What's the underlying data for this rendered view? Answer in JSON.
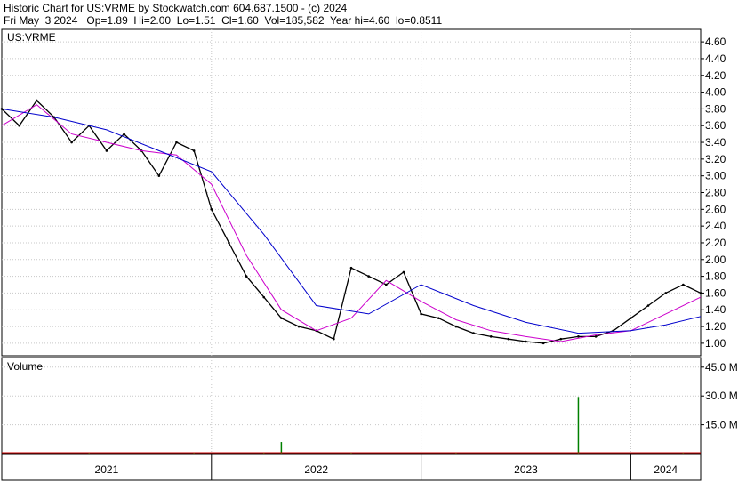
{
  "header": {
    "title": "Historic Chart for US:VRME by Stockwatch.com 604.687.1500 - (c) 2024",
    "quote": "Fri May  3 2024   Op=1.89  Hi=2.00  Lo=1.51  Cl=1.60  Vol=185,582  Year hi=4.60  lo=0.8511"
  },
  "colors": {
    "price": "#000000",
    "ma_short": "#cc00cc",
    "ma_long": "#0000cc",
    "volume_up": "#008000",
    "volume_down": "#cc0000",
    "grid": "#c8c8c8",
    "frame": "#000000"
  },
  "chart_data": [
    {
      "type": "line",
      "panel": "price",
      "symbol_label": "US:VRME",
      "ylim": [
        0.85,
        4.75
      ],
      "y_ticks": [
        "4.60",
        "4.40",
        "4.20",
        "4.00",
        "3.80",
        "3.60",
        "3.40",
        "3.20",
        "3.00",
        "2.80",
        "2.60",
        "2.40",
        "2.20",
        "2.00",
        "1.80",
        "1.60",
        "1.40",
        "1.20",
        "1.00"
      ],
      "x_ticks": [
        "2021",
        "2022",
        "2023",
        "2024"
      ],
      "x_range": [
        "2021-01",
        "2024-05"
      ],
      "grid": true,
      "series": [
        {
          "role": "price",
          "x": [
            "2021-01",
            "2021-02",
            "2021-03",
            "2021-04",
            "2021-05",
            "2021-06",
            "2021-07",
            "2021-08",
            "2021-09",
            "2021-10",
            "2021-11",
            "2021-12",
            "2022-01",
            "2022-02",
            "2022-03",
            "2022-04",
            "2022-05",
            "2022-06",
            "2022-07",
            "2022-08",
            "2022-09",
            "2022-10",
            "2022-11",
            "2022-12",
            "2023-01",
            "2023-02",
            "2023-03",
            "2023-04",
            "2023-05",
            "2023-06",
            "2023-07",
            "2023-08",
            "2023-09",
            "2023-10",
            "2023-11",
            "2023-12",
            "2024-01",
            "2024-02",
            "2024-03",
            "2024-04",
            "2024-05"
          ],
          "values": [
            3.8,
            3.6,
            3.9,
            3.7,
            3.4,
            3.6,
            3.3,
            3.5,
            3.3,
            3.0,
            3.4,
            3.3,
            2.6,
            2.2,
            1.8,
            1.55,
            1.3,
            1.2,
            1.15,
            1.05,
            1.9,
            1.8,
            1.7,
            1.85,
            1.35,
            1.3,
            1.2,
            1.12,
            1.08,
            1.05,
            1.02,
            1.0,
            1.05,
            1.08,
            1.08,
            1.15,
            1.3,
            1.45,
            1.6,
            1.7,
            1.6
          ]
        },
        {
          "role": "moving-average-short",
          "x": [
            "2021-01",
            "2021-03",
            "2021-05",
            "2021-07",
            "2021-09",
            "2021-11",
            "2022-01",
            "2022-03",
            "2022-05",
            "2022-07",
            "2022-09",
            "2022-11",
            "2023-01",
            "2023-03",
            "2023-05",
            "2023-07",
            "2023-09",
            "2023-11",
            "2024-01",
            "2024-03",
            "2024-05"
          ],
          "values": [
            3.6,
            3.85,
            3.5,
            3.4,
            3.3,
            3.25,
            2.9,
            2.05,
            1.4,
            1.15,
            1.3,
            1.75,
            1.5,
            1.28,
            1.15,
            1.08,
            1.02,
            1.1,
            1.15,
            1.35,
            1.55
          ]
        },
        {
          "role": "moving-average-long",
          "x": [
            "2021-01",
            "2021-04",
            "2021-07",
            "2021-10",
            "2022-01",
            "2022-04",
            "2022-07",
            "2022-10",
            "2023-01",
            "2023-04",
            "2023-07",
            "2023-10",
            "2024-01",
            "2024-03",
            "2024-05"
          ],
          "values": [
            3.8,
            3.7,
            3.55,
            3.3,
            3.05,
            2.3,
            1.45,
            1.35,
            1.7,
            1.45,
            1.25,
            1.12,
            1.15,
            1.22,
            1.32
          ]
        }
      ]
    },
    {
      "type": "bar",
      "panel": "volume",
      "panel_label": "Volume",
      "ylim": [
        0,
        50
      ],
      "y_ticks": [
        "45.0 M",
        "30.0 M",
        "15.0 M"
      ],
      "bars": [
        {
          "date": "2021-06",
          "value": 0.4
        },
        {
          "date": "2021-12",
          "value": 0.3
        },
        {
          "date": "2022-04",
          "value": 0.3
        },
        {
          "date": "2022-05",
          "value": 6.0
        },
        {
          "date": "2022-09",
          "value": 0.5
        },
        {
          "date": "2023-03",
          "value": 0.3
        },
        {
          "date": "2023-10",
          "value": 29.5
        },
        {
          "date": "2024-04",
          "value": 0.6
        }
      ]
    }
  ]
}
